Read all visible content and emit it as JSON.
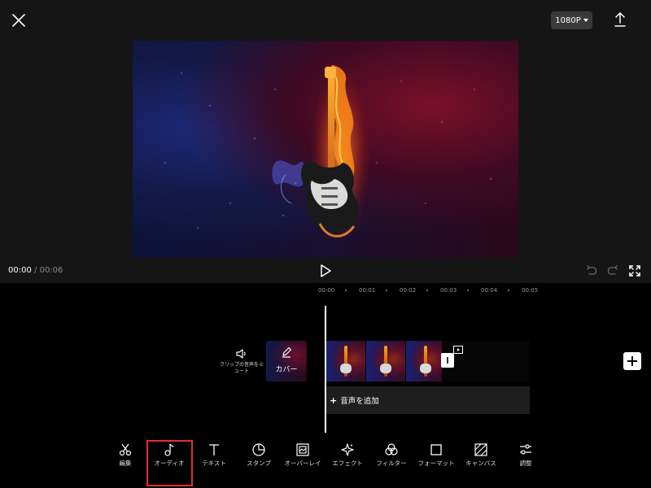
{
  "header": {
    "close_icon": "close-icon",
    "resolution": "1080P",
    "export_icon": "upload-icon"
  },
  "player": {
    "current_time": "00:00",
    "separator": "/",
    "total_time": "00:06",
    "icons": [
      "play-icon",
      "undo-icon",
      "redo-icon",
      "fullscreen-icon"
    ]
  },
  "timeline": {
    "ruler": [
      "00:00",
      "00:01",
      "00:02",
      "00:03",
      "00:04",
      "00:05"
    ],
    "mute_label": "クリップの音声をミュート",
    "cover_label": "カバー",
    "add_audio_plus": "+",
    "add_audio_label": "音声を追加",
    "frame_count": 3
  },
  "toolbar": {
    "selected": "audio",
    "items": [
      {
        "id": "edit",
        "label": "編集",
        "icon": "scissors-icon"
      },
      {
        "id": "audio",
        "label": "オーディオ",
        "icon": "music-note-icon"
      },
      {
        "id": "text",
        "label": "テキスト",
        "icon": "text-icon"
      },
      {
        "id": "sticker",
        "label": "スタンプ",
        "icon": "sticker-icon"
      },
      {
        "id": "overlay",
        "label": "オーバーレイ",
        "icon": "overlay-icon"
      },
      {
        "id": "effect",
        "label": "エフェクト",
        "icon": "sparkle-icon"
      },
      {
        "id": "filter",
        "label": "フィルター",
        "icon": "filter-icon"
      },
      {
        "id": "format",
        "label": "フォーマット",
        "icon": "square-icon"
      },
      {
        "id": "canvas",
        "label": "キャンバス",
        "icon": "canvas-icon"
      },
      {
        "id": "adjust",
        "label": "調整",
        "icon": "sliders-icon"
      }
    ]
  }
}
